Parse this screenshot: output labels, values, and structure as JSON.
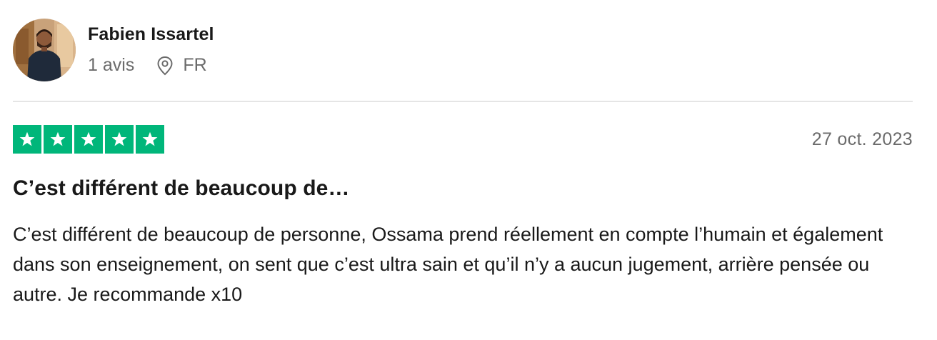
{
  "consumer": {
    "name": "Fabien Issartel",
    "review_count": "1 avis",
    "country": "FR",
    "avatar_icon": "user-photo-avatar",
    "location_icon": "location-pin-icon"
  },
  "review": {
    "rating": 5,
    "rating_max": 5,
    "star_color": "#00b67a",
    "date": "27 oct. 2023",
    "title": "C’est différent de beaucoup de…",
    "body": "C’est différent de beaucoup de personne, Ossama prend réellement en compte l’humain et également dans son enseignement, on sent que c’est ultra sain et qu’il n’y a aucun jugement, arrière pensée ou autre. Je recommande x10"
  }
}
